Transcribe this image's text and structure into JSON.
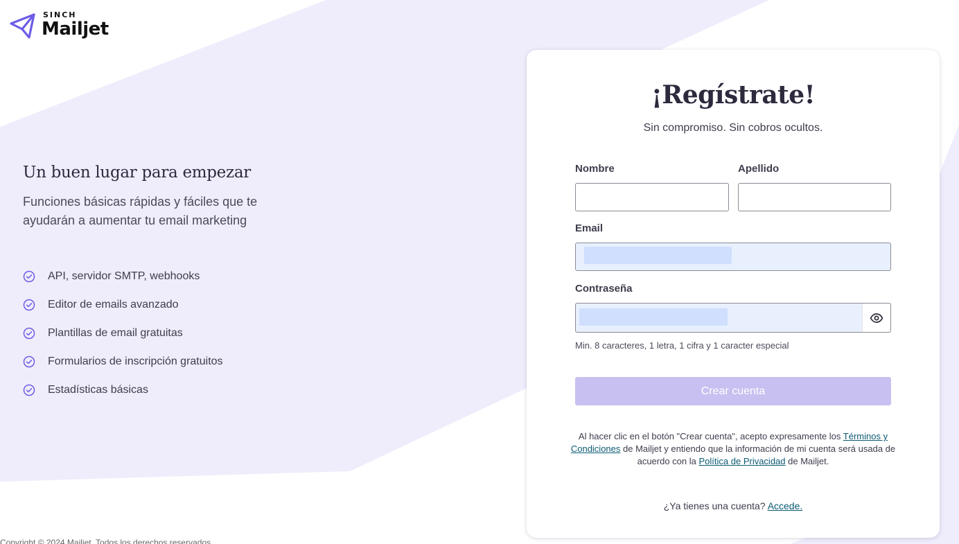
{
  "brand": {
    "parent": "SINCH",
    "name": "Mailjet",
    "accent_color": "#6c5ce7",
    "button_disabled_color": "#c8c0f0",
    "background_shape_color": "#efedfb",
    "link_color": "#0a5a72"
  },
  "left": {
    "heading": "Un buen lugar para empezar",
    "lead": "Funciones básicas rápidas y fáciles que te ayudarán a aumentar tu email marketing",
    "features": [
      "API, servidor SMTP, webhooks",
      "Editor de emails avanzado",
      "Plantillas de email gratuitas",
      "Formularios de inscripción gratuitos",
      "Estadísticas básicas"
    ],
    "feature_icon": "check-circle-icon",
    "copyright": "Copyright © 2024 Mailjet. Todos los derechos reservados."
  },
  "form": {
    "title": "¡Regístrate!",
    "subtitle": "Sin compromiso. Sin cobros ocultos.",
    "first_name": {
      "label": "Nombre",
      "value": ""
    },
    "last_name": {
      "label": "Apellido",
      "value": ""
    },
    "email": {
      "label": "Email",
      "value": ""
    },
    "password": {
      "label": "Contraseña",
      "value": "",
      "hint": "Min. 8 caracteres, 1 letra, 1 cifra y 1 caracter especial",
      "toggle_icon": "eye-icon"
    },
    "submit_label": "Crear cuenta",
    "legal": {
      "before": "Al hacer clic en el botón \"Crear cuenta\", acepto expresamente los ",
      "terms_link": "Términos y Condiciones",
      "middle": " de Mailjet y entiendo que la información de mi cuenta será usada de acuerdo con la ",
      "privacy_link": "Política de Privacidad",
      "after": " de Mailjet."
    },
    "signin": {
      "prompt": "¿Ya tienes una cuenta? ",
      "link": "Accede."
    }
  }
}
